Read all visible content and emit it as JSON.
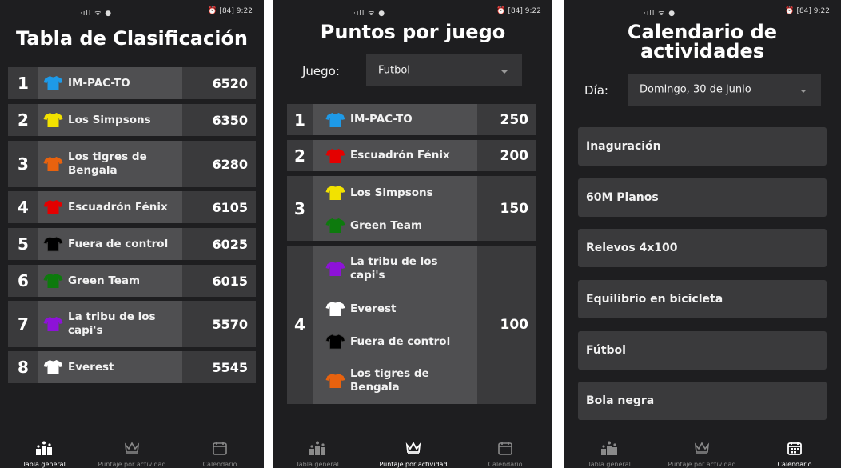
{
  "status": {
    "time": "9:22",
    "battery": "84",
    "left_icons": "·ıll ᯤ ●"
  },
  "screen1": {
    "title": "Tabla de Clasificación",
    "rows": [
      {
        "rank": "1",
        "team": "IM-PAC-TO",
        "points": "6520",
        "shirt_color": "#1e9ae8"
      },
      {
        "rank": "2",
        "team": "Los Simpsons",
        "points": "6350",
        "shirt_color": "#f2e200"
      },
      {
        "rank": "3",
        "team": "Los tigres de Bengala",
        "points": "6280",
        "shirt_color": "#e8620e"
      },
      {
        "rank": "4",
        "team": "Escuadrón Fénix",
        "points": "6105",
        "shirt_color": "#e40000"
      },
      {
        "rank": "5",
        "team": "Fuera de control",
        "points": "6025",
        "shirt_color": "#000000"
      },
      {
        "rank": "6",
        "team": "Green Team",
        "points": "6015",
        "shirt_color": "#0d7a0d"
      },
      {
        "rank": "7",
        "team": "La tribu de los capi's",
        "points": "5570",
        "shirt_color": "#8d12d8"
      },
      {
        "rank": "8",
        "team": "Everest",
        "points": "5545",
        "shirt_color": "#ffffff"
      }
    ]
  },
  "screen2": {
    "title": "Puntos por juego",
    "game_label": "Juego:",
    "game_value": "Futbol",
    "groups": [
      {
        "rank": "1",
        "points": "250",
        "teams": [
          {
            "name": "IM-PAC-TO",
            "shirt_color": "#1e9ae8"
          }
        ]
      },
      {
        "rank": "2",
        "points": "200",
        "teams": [
          {
            "name": "Escuadrón Fénix",
            "shirt_color": "#e40000"
          }
        ]
      },
      {
        "rank": "3",
        "points": "150",
        "teams": [
          {
            "name": "Los Simpsons",
            "shirt_color": "#f2e200"
          },
          {
            "name": "Green Team",
            "shirt_color": "#0d7a0d"
          }
        ]
      },
      {
        "rank": "4",
        "points": "100",
        "teams": [
          {
            "name": "La tribu de los capi's",
            "shirt_color": "#8d12d8"
          },
          {
            "name": "Everest",
            "shirt_color": "#ffffff"
          },
          {
            "name": "Fuera de control",
            "shirt_color": "#000000"
          },
          {
            "name": "Los tigres de Bengala",
            "shirt_color": "#e8620e"
          }
        ]
      }
    ]
  },
  "screen3": {
    "title": "Calendario de actividades",
    "day_label": "Día:",
    "day_value": "Domingo, 30 de junio",
    "activities": [
      "Inaguración",
      "60M Planos",
      "Relevos 4x100",
      "Equilibrio en bicicleta",
      "Fútbol",
      "Bola negra"
    ]
  },
  "nav": [
    {
      "label": "Tabla general",
      "icon": "podium-icon"
    },
    {
      "label": "Puntaje por actividad",
      "icon": "crown-icon"
    },
    {
      "label": "Calendario",
      "icon": "calendar-icon"
    }
  ]
}
